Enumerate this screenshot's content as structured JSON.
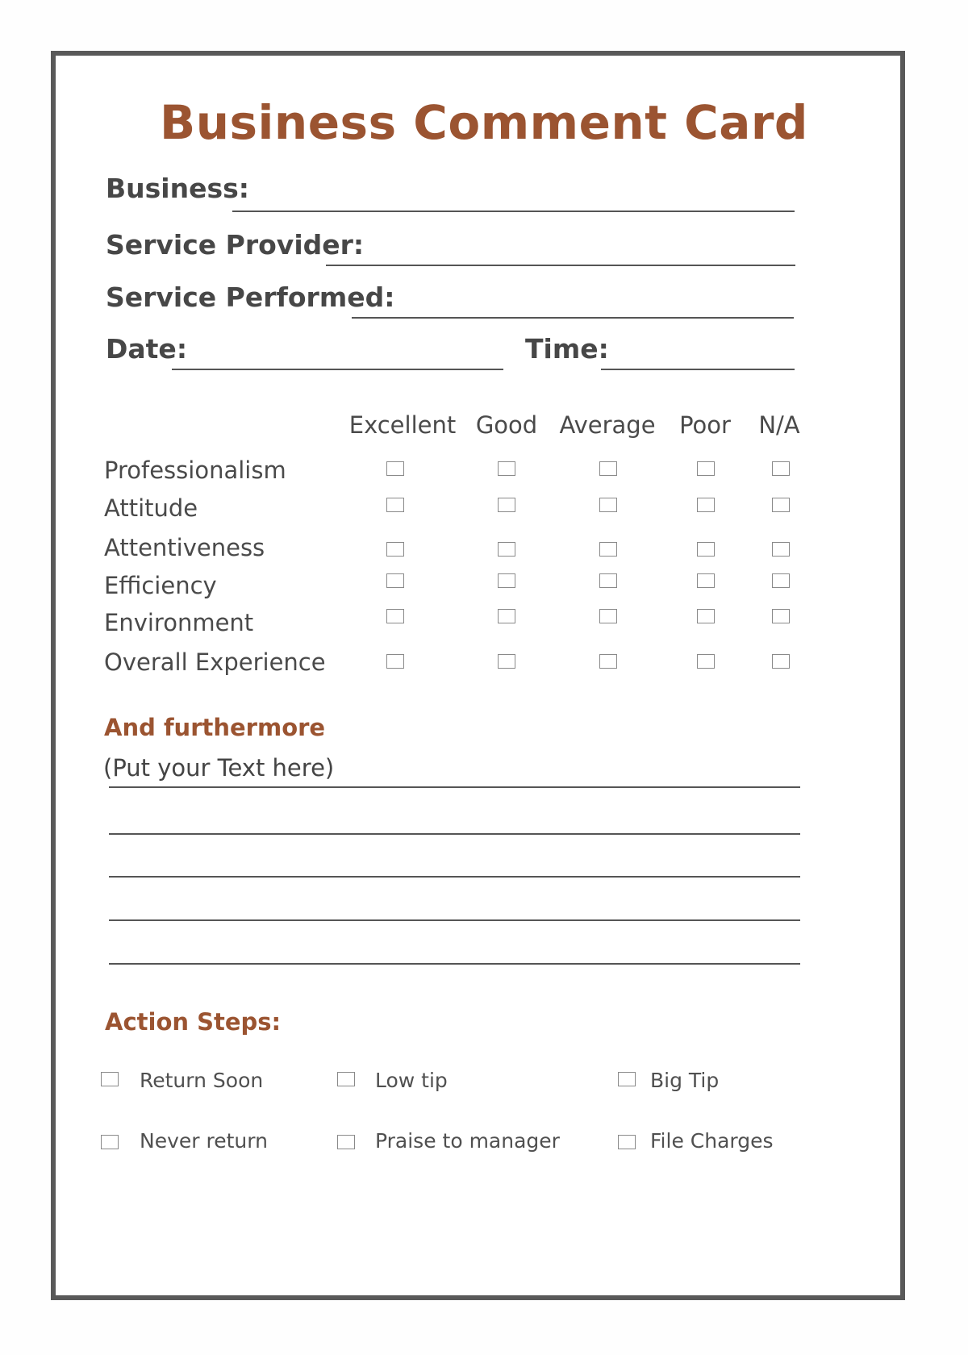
{
  "card": {
    "title": "Business Comment Card",
    "fields": {
      "business": {
        "label": "Business:",
        "value": ""
      },
      "service_provider": {
        "label": "Service Provider:",
        "value": ""
      },
      "service_performed": {
        "label": "Service Performed:",
        "value": ""
      },
      "date": {
        "label": "Date:",
        "value": ""
      },
      "time": {
        "label": "Time:",
        "value": ""
      }
    },
    "rating": {
      "columns": [
        "Excellent",
        "Good",
        "Average",
        "Poor",
        "N/A"
      ],
      "rows": [
        {
          "label": "Professionalism",
          "selected": null
        },
        {
          "label": "Attitude",
          "selected": null
        },
        {
          "label": "Attentiveness",
          "selected": null
        },
        {
          "label": "Efficiency",
          "selected": null
        },
        {
          "label": "Environment",
          "selected": null
        },
        {
          "label": "Overall Experience",
          "selected": null
        }
      ]
    },
    "comments": {
      "heading": "And furthermore",
      "placeholder": "(Put your Text here)",
      "line_count": 5
    },
    "actions": {
      "heading": "Action Steps:",
      "items": [
        {
          "label": "Return Soon",
          "checked": false
        },
        {
          "label": "Low tip",
          "checked": false
        },
        {
          "label": "Big Tip",
          "checked": false
        },
        {
          "label": "Never return",
          "checked": false
        },
        {
          "label": "Praise to manager",
          "checked": false
        },
        {
          "label": "File Charges",
          "checked": false
        }
      ]
    },
    "colors": {
      "accent": "#9b5431",
      "frame": "#595959",
      "text": "#474747"
    }
  }
}
